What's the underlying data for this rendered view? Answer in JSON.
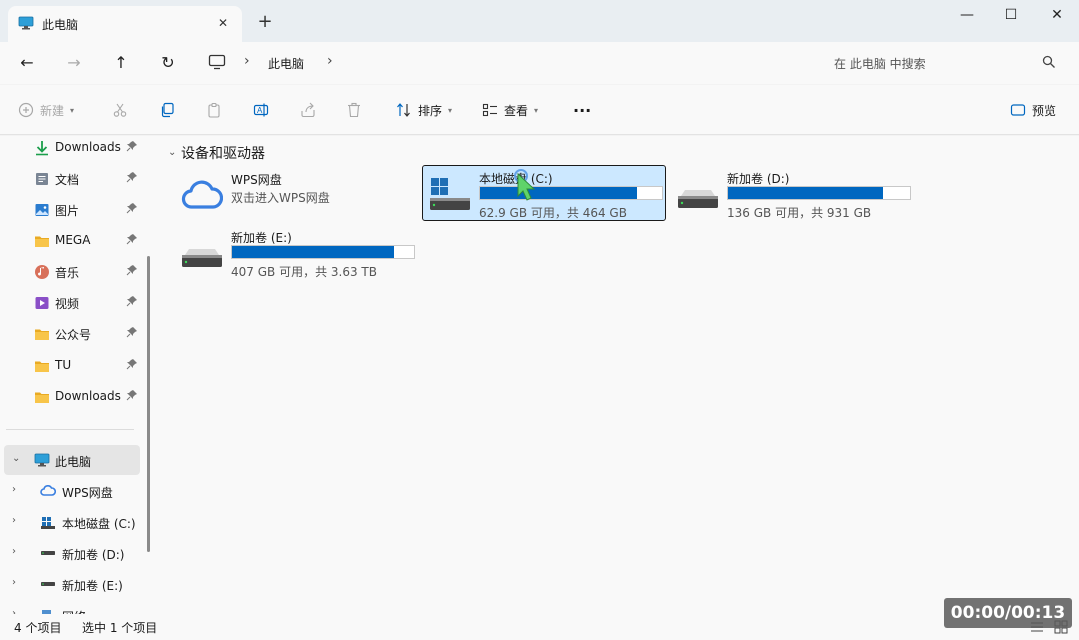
{
  "window": {
    "tab_title": "此电脑",
    "tab_close": "✕",
    "new_tab": "+",
    "minimize": "—",
    "maximize": "☐",
    "close": "✕"
  },
  "nav": {
    "back": "←",
    "forward": "→",
    "up": "↑",
    "refresh": "↻",
    "breadcrumb_sep": "›",
    "breadcrumb": [
      "此电脑"
    ],
    "search_placeholder": "在 此电脑 中搜索"
  },
  "commands": {
    "new_label": "新建",
    "sort_label": "排序",
    "view_label": "查看",
    "more_label": "···",
    "preview_label": "预览"
  },
  "sidebar": {
    "quick_access": [
      {
        "label": "Downloads",
        "icon": "download-icon"
      },
      {
        "label": "文档",
        "icon": "document-icon"
      },
      {
        "label": "图片",
        "icon": "picture-icon"
      },
      {
        "label": "MEGA",
        "icon": "folder-icon"
      },
      {
        "label": "音乐",
        "icon": "music-icon"
      },
      {
        "label": "视频",
        "icon": "video-icon"
      },
      {
        "label": "公众号",
        "icon": "folder-icon"
      },
      {
        "label": "TU",
        "icon": "folder-icon"
      },
      {
        "label": "Downloads",
        "icon": "folder-icon"
      }
    ],
    "this_pc": "此电脑",
    "tree": [
      {
        "label": "WPS网盘",
        "icon": "cloud-icon"
      },
      {
        "label": "本地磁盘 (C:)",
        "icon": "windows-drive-icon"
      },
      {
        "label": "新加卷 (D:)",
        "icon": "drive-icon"
      },
      {
        "label": "新加卷 (E:)",
        "icon": "drive-icon"
      }
    ],
    "partial_item": "网络"
  },
  "main": {
    "group_title": "设备和驱动器",
    "drives": [
      {
        "name": "WPS网盘",
        "desc": "双击进入WPS网盘"
      },
      {
        "name": "本地磁盘 (C:)",
        "space": "62.9 GB 可用，共 464 GB",
        "used_fraction": 0.864
      },
      {
        "name": "新加卷 (D:)",
        "space": "136 GB 可用，共 931 GB",
        "used_fraction": 0.854
      },
      {
        "name": "新加卷 (E:)",
        "space": "407 GB 可用，共 3.63 TB",
        "used_fraction": 0.891
      }
    ]
  },
  "status": {
    "item_count": "4 个项目",
    "selected": "选中 1 个项目"
  },
  "overlay": {
    "timer": "00:00/00:13"
  },
  "colors": {
    "accent": "#0067c0",
    "selection": "#cce8ff",
    "folder": "#f8c54a"
  }
}
